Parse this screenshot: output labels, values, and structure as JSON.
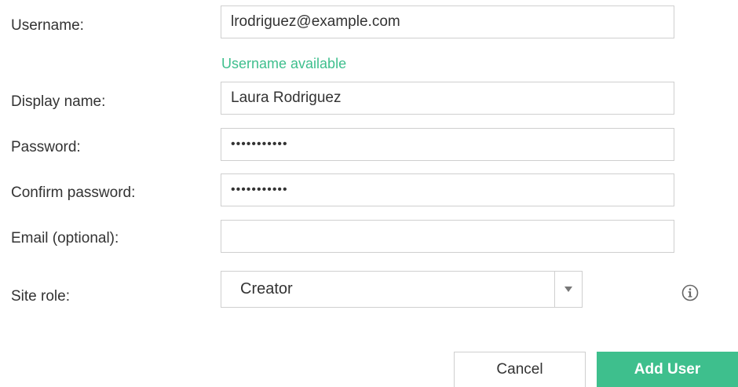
{
  "form": {
    "username": {
      "label": "Username:",
      "value": "lrodriguez@example.com"
    },
    "username_hint": "Username available",
    "display_name": {
      "label": "Display name:",
      "value": "Laura Rodriguez"
    },
    "password": {
      "label": "Password:",
      "value": "•••••••••••"
    },
    "confirm_password": {
      "label": "Confirm password:",
      "value": "•••••••••••"
    },
    "email": {
      "label": "Email (optional):",
      "value": ""
    },
    "site_role": {
      "label": "Site role:",
      "selected": "Creator"
    }
  },
  "icons": {
    "info": "info-icon",
    "dropdown": "chevron-down-icon"
  },
  "buttons": {
    "cancel": "Cancel",
    "add_user": "Add User"
  },
  "colors": {
    "accent": "#3ebf8d",
    "border": "#cfcfcf",
    "text": "#333333"
  }
}
